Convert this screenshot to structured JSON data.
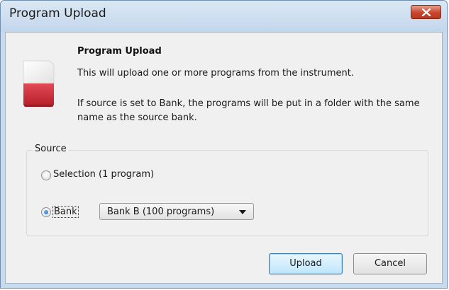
{
  "window": {
    "title": "Program Upload",
    "icons": {
      "close": "close-icon",
      "app": "document-icon"
    },
    "colors": {
      "close_button": "#c8452b",
      "icon_red": "#d62e3a",
      "default_button_border": "#3c7fb1"
    }
  },
  "content": {
    "heading": "Program Upload",
    "description_1": "This will upload one or more programs from the instrument.",
    "description_2": "If source is set to Bank, the programs will be put in a folder with the same name as the source bank."
  },
  "source": {
    "group_label": "Source",
    "options": [
      {
        "label": "Selection (1 program)",
        "selected": false
      },
      {
        "label": "Bank",
        "selected": true
      }
    ],
    "bank_select": {
      "value": "Bank B (100 programs)"
    }
  },
  "buttons": {
    "upload": "Upload",
    "cancel": "Cancel"
  }
}
